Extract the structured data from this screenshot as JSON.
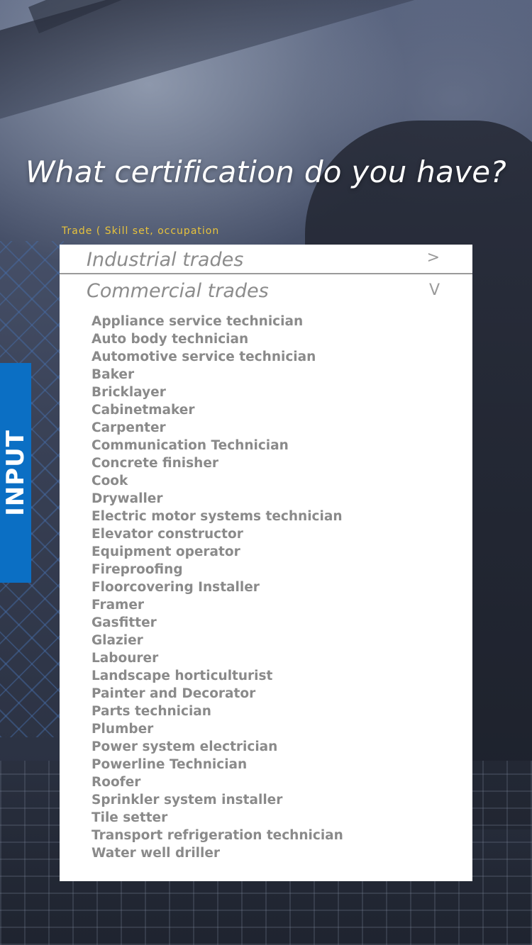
{
  "heading": "What certification do you have?",
  "field_label": "Trade ( Skill set, occupation",
  "side_tab": "INPUT",
  "accordion": [
    {
      "title": "Industrial trades",
      "chevron": ">"
    },
    {
      "title": "Commercial trades",
      "chevron": "V"
    }
  ],
  "commercial_trades": [
    "Appliance service technician",
    "Auto body technician",
    "Automotive service technician",
    "Baker",
    "Bricklayer",
    "Cabinetmaker",
    "Carpenter",
    "Communication Technician",
    "Concrete finisher",
    "Cook",
    "Drywaller",
    "Electric motor systems technician",
    "Elevator constructor",
    "Equipment operator",
    "Fireproofing",
    "Floorcovering Installer",
    "Framer",
    "Gasfitter",
    "Glazier",
    "Labourer",
    "Landscape horticulturist",
    "Painter and Decorator",
    "Parts technician",
    "Plumber",
    "Power system electrician",
    "Powerline Technician",
    "Roofer",
    "Sprinkler system installer",
    "Tile setter",
    "Transport refrigeration technician",
    "Water well driller"
  ],
  "colors": {
    "accent_blue": "#0b6fc4",
    "label_yellow": "#e8c33c",
    "list_text": "#8a8a8a",
    "panel_bg": "#ffffff"
  }
}
